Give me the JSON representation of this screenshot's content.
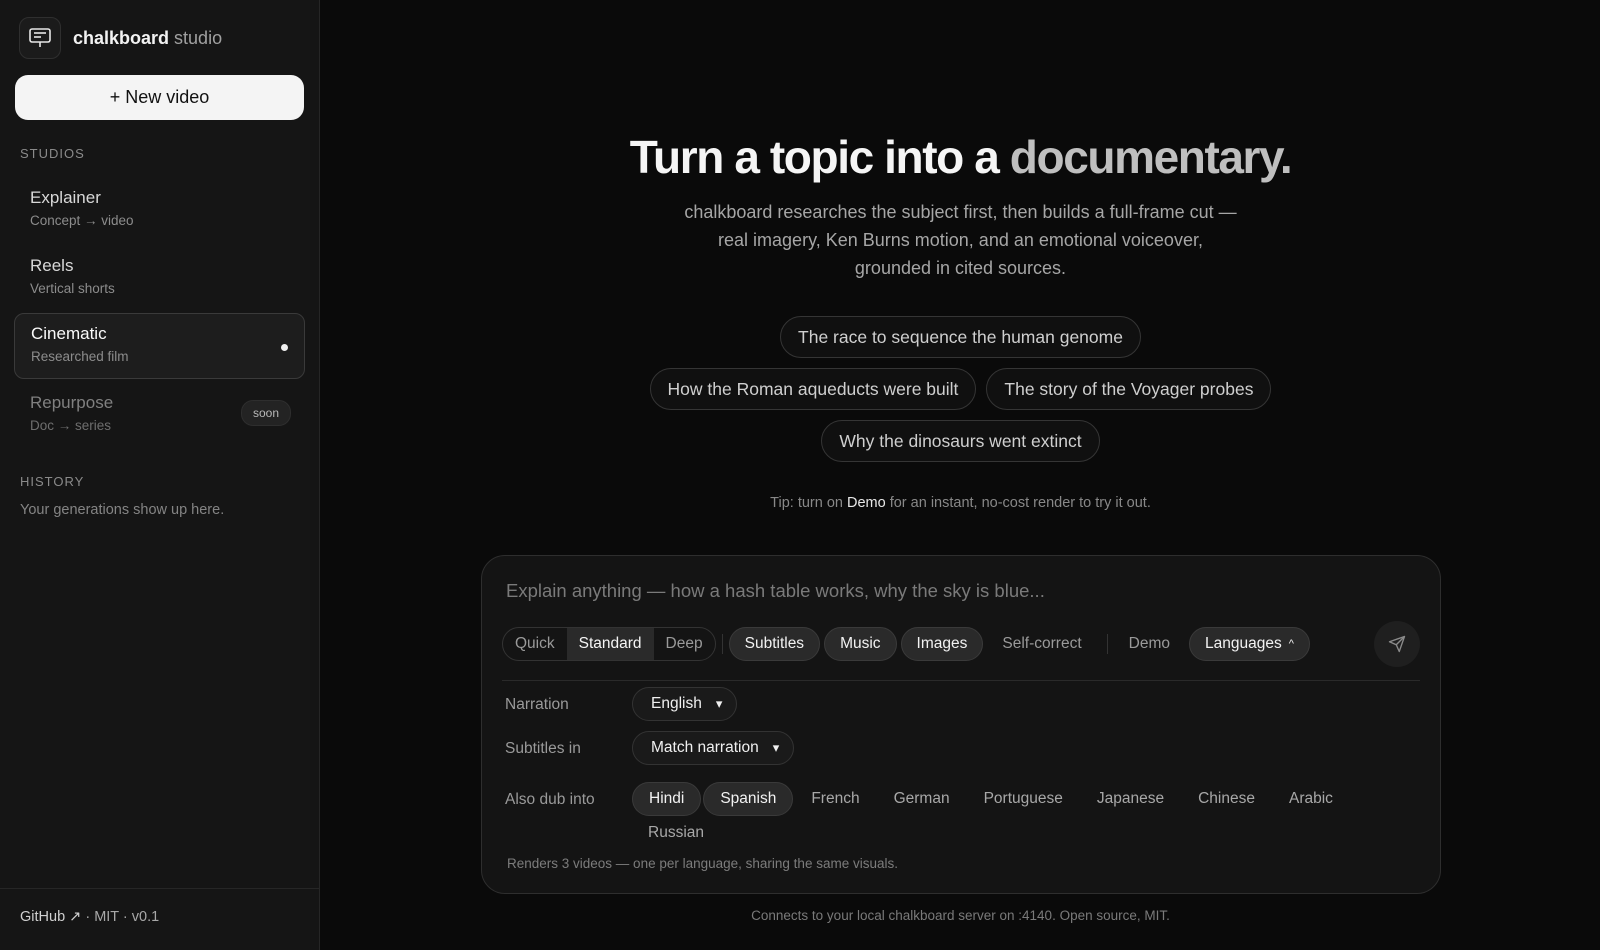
{
  "brand": {
    "name": "chalkboard",
    "suffix": "studio"
  },
  "sidebar": {
    "new_video": "+ New video",
    "studios_label": "STUDIOS",
    "studios": [
      {
        "title": "Explainer",
        "subtitle": "Concept → video"
      },
      {
        "title": "Reels",
        "subtitle": "Vertical shorts"
      },
      {
        "title": "Cinematic",
        "subtitle": "Researched film"
      },
      {
        "title": "Repurpose",
        "subtitle": "Doc → series",
        "badge": "soon"
      }
    ],
    "history_label": "HISTORY",
    "history_empty": "Your generations show up here.",
    "footer": {
      "github": "GitHub ↗",
      "meta": " · MIT · v0.1"
    }
  },
  "hero": {
    "title_main": "Turn a topic into a ",
    "title_fade": "documentary.",
    "description": "chalkboard researches the subject first, then builds a full-frame cut — real imagery, Ken Burns motion, and an emotional voiceover, grounded in cited sources."
  },
  "suggestions": [
    "The race to sequence the human genome",
    "How the Roman aqueducts were built",
    "The story of the Voyager probes",
    "Why the dinosaurs went extinct"
  ],
  "tip": {
    "before": "Tip: turn on ",
    "highlight": "Demo",
    "after": " for an instant, no-cost render to try it out."
  },
  "composer": {
    "placeholder": "Explain anything — how a hash table works, why the sky is blue...",
    "depth": [
      "Quick",
      "Standard",
      "Deep"
    ],
    "toggles": [
      "Subtitles",
      "Music",
      "Images",
      "Self-correct"
    ],
    "demo": "Demo",
    "languages": "Languages",
    "narration_label": "Narration",
    "narration_value": "English",
    "subtitles_label": "Subtitles in",
    "subtitles_value": "Match narration",
    "dub_label": "Also dub into",
    "dub_languages": [
      "Hindi",
      "Spanish",
      "French",
      "German",
      "Portuguese",
      "Japanese",
      "Chinese",
      "Arabic",
      "Russian"
    ],
    "renders_note": "Renders 3 videos — one per language, sharing the same visuals."
  },
  "footer_note": "Connects to your local chalkboard server on :4140. Open source, MIT."
}
